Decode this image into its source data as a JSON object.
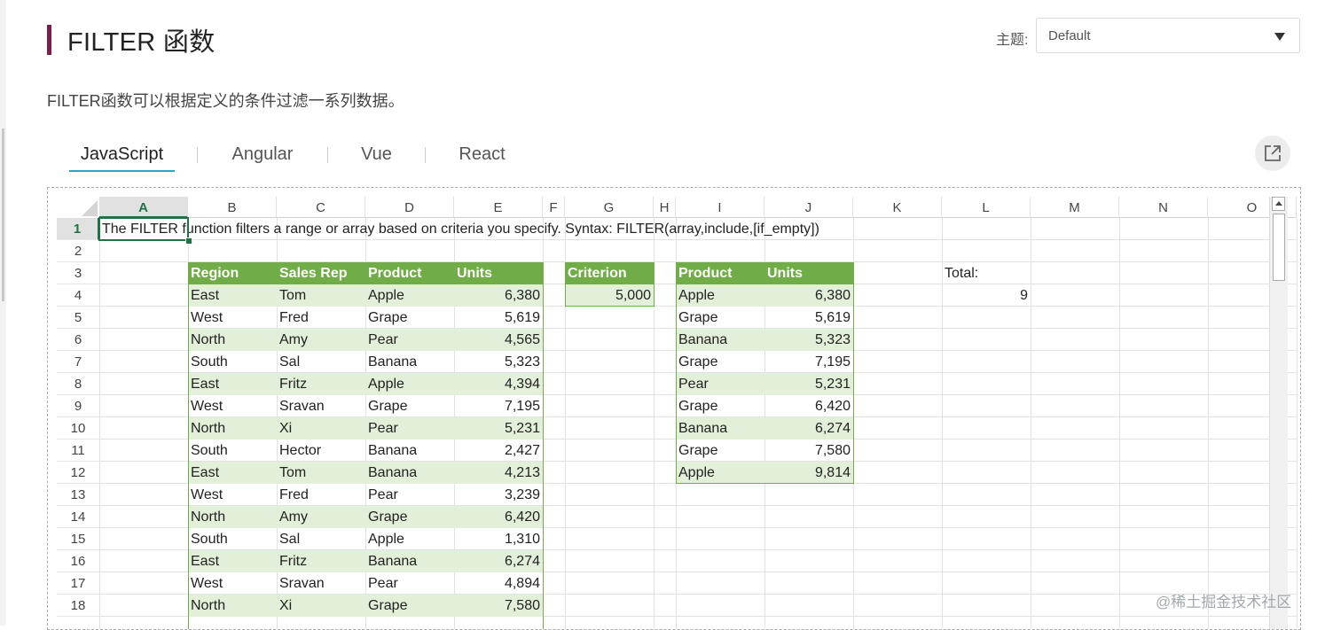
{
  "page": {
    "title": "FILTER 函数",
    "description": "FILTER函数可以根据定义的条件过滤一系列数据。",
    "watermark": "@稀土掘金技术社区"
  },
  "theme": {
    "label": "主题:",
    "selected": "Default"
  },
  "tabs": [
    {
      "label": "JavaScript",
      "active": true
    },
    {
      "label": "Angular",
      "active": false
    },
    {
      "label": "Vue",
      "active": false
    },
    {
      "label": "React",
      "active": false
    }
  ],
  "colors": {
    "accent_bar": "#7a1f4b",
    "tab_underline": "#2ca5c5",
    "table_header": "#70ad47",
    "table_band": "#e2efd9",
    "selection": "#217346"
  },
  "spreadsheet": {
    "selected_cell": "A1",
    "column_headers": [
      "A",
      "B",
      "C",
      "D",
      "E",
      "F",
      "G",
      "H",
      "I",
      "J",
      "K",
      "L",
      "M",
      "N",
      "O"
    ],
    "row_headers": [
      "1",
      "2",
      "3",
      "4",
      "5",
      "6",
      "7",
      "8",
      "9",
      "10",
      "11",
      "12",
      "13",
      "14",
      "15",
      "16",
      "17",
      "18"
    ],
    "a1_text": "The FILTER function filters a range or array based on criteria you specify. Syntax: FILTER(array,include,[if_empty])",
    "source_table": {
      "headers": [
        "Region",
        "Sales Rep",
        "Product",
        "Units"
      ],
      "rows": [
        [
          "East",
          "Tom",
          "Apple",
          "6,380"
        ],
        [
          "West",
          "Fred",
          "Grape",
          "5,619"
        ],
        [
          "North",
          "Amy",
          "Pear",
          "4,565"
        ],
        [
          "South",
          "Sal",
          "Banana",
          "5,323"
        ],
        [
          "East",
          "Fritz",
          "Apple",
          "4,394"
        ],
        [
          "West",
          "Sravan",
          "Grape",
          "7,195"
        ],
        [
          "North",
          "Xi",
          "Pear",
          "5,231"
        ],
        [
          "South",
          "Hector",
          "Banana",
          "2,427"
        ],
        [
          "East",
          "Tom",
          "Banana",
          "4,213"
        ],
        [
          "West",
          "Fred",
          "Pear",
          "3,239"
        ],
        [
          "North",
          "Amy",
          "Grape",
          "6,420"
        ],
        [
          "South",
          "Sal",
          "Apple",
          "1,310"
        ],
        [
          "East",
          "Fritz",
          "Banana",
          "6,274"
        ],
        [
          "West",
          "Sravan",
          "Pear",
          "4,894"
        ],
        [
          "North",
          "Xi",
          "Grape",
          "7,580"
        ]
      ]
    },
    "criterion": {
      "header": "Criterion",
      "value": "5,000"
    },
    "result_table": {
      "headers": [
        "Product",
        "Units"
      ],
      "rows": [
        [
          "Apple",
          "6,380"
        ],
        [
          "Grape",
          "5,619"
        ],
        [
          "Banana",
          "5,323"
        ],
        [
          "Grape",
          "7,195"
        ],
        [
          "Pear",
          "5,231"
        ],
        [
          "Grape",
          "6,420"
        ],
        [
          "Banana",
          "6,274"
        ],
        [
          "Grape",
          "7,580"
        ],
        [
          "Apple",
          "9,814"
        ]
      ]
    },
    "total": {
      "label": "Total:",
      "value": "9"
    }
  }
}
